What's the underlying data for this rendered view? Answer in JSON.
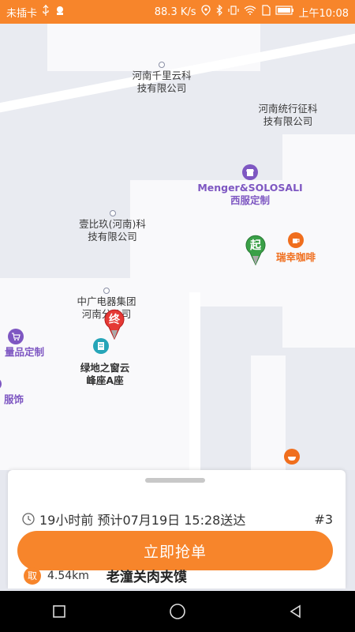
{
  "status_bar": {
    "carrier": "未插卡",
    "speed": "88.3 K/s",
    "time": "上午10:08"
  },
  "map": {
    "pois": [
      {
        "name": "河南千里云科\n技有限公司"
      },
      {
        "name": "河南统行征科\n技有限公司"
      },
      {
        "name": "Menger&SOLOSALI\n西服定制"
      },
      {
        "name": "壹比玖(河南)科\n技有限公司"
      },
      {
        "name": "瑞幸咖啡"
      },
      {
        "name": "中广电器集团\n河南分公司"
      },
      {
        "name": "绿地之窗云\n峰座A座"
      },
      {
        "name": "量品定制"
      },
      {
        "name": "服饰"
      }
    ],
    "start_marker": "起",
    "end_marker": "终"
  },
  "order": {
    "time_text": "19小时前 预计07月19日 15:28送达",
    "number": "#3",
    "grab_label": "立即抢单",
    "pickup_badge": "取",
    "distance": "4.54km",
    "store": "老潼关肉夹馍"
  },
  "colors": {
    "accent": "#f7852b",
    "poi_purple": "#7e57c2",
    "poi_orange": "#f06e1d"
  }
}
